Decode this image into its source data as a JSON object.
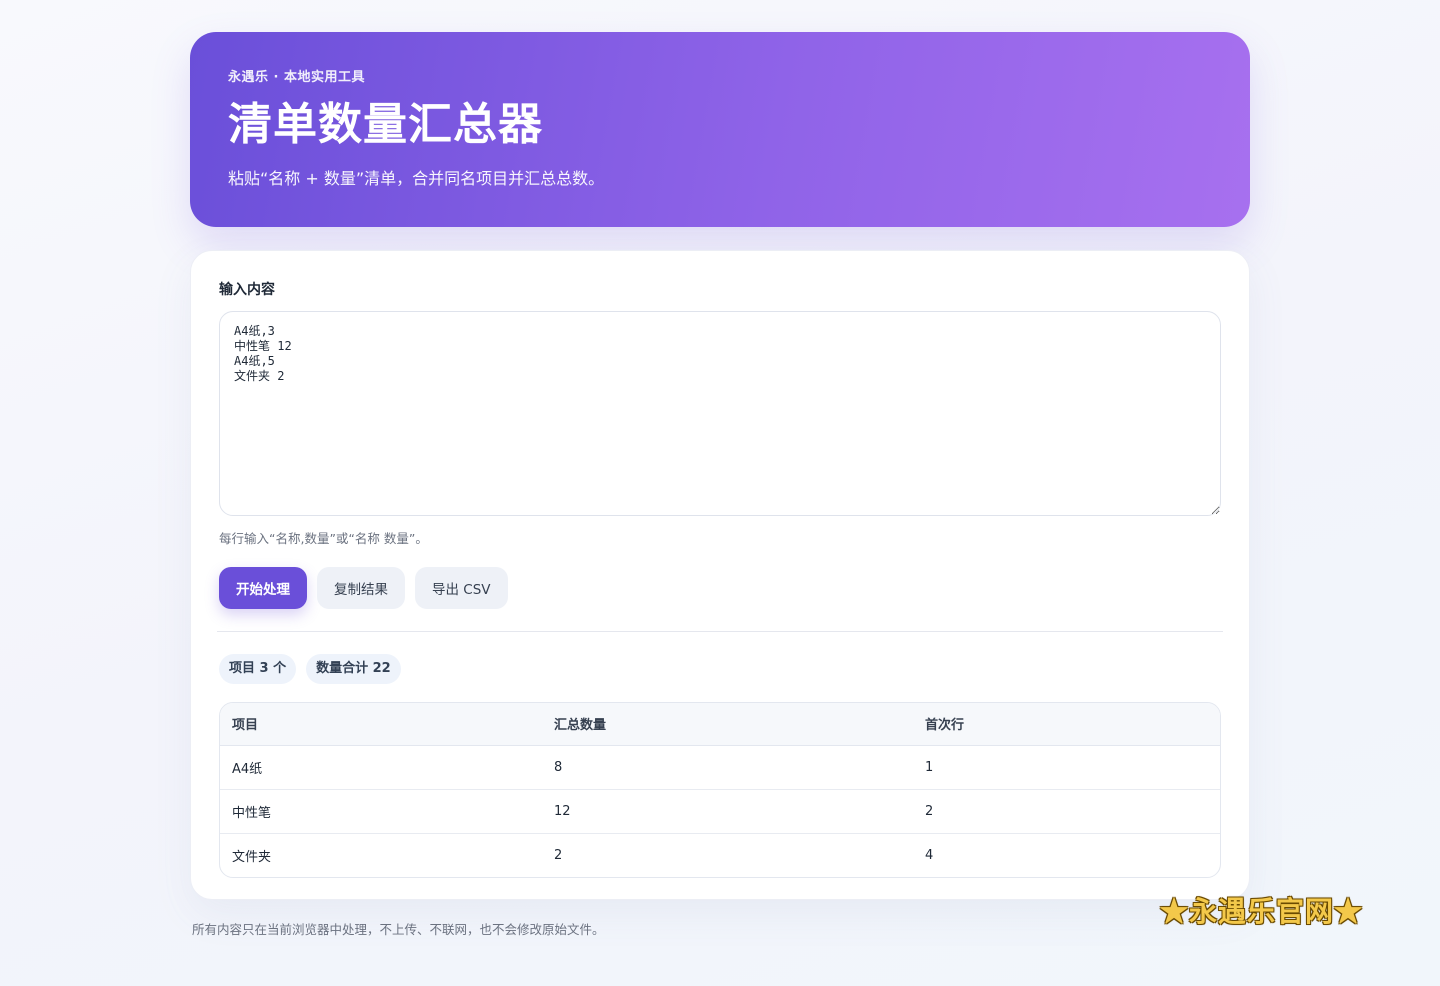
{
  "hero": {
    "kicker": "永遇乐 · 本地实用工具",
    "title": "清单数量汇总器",
    "subtitle": "粘贴“名称 + 数量”清单，合并同名项目并汇总总数。"
  },
  "input": {
    "label": "输入内容",
    "value": "A4纸,3\n中性笔 12\nA4纸,5\n文件夹 2",
    "hint": "每行输入“名称,数量”或“名称 数量”。"
  },
  "buttons": {
    "process": "开始处理",
    "copy": "复制结果",
    "export": "导出 CSV"
  },
  "summary": {
    "items": "项目 3 个",
    "total": "数量合计 22"
  },
  "table": {
    "headers": [
      "项目",
      "汇总数量",
      "首次行"
    ],
    "rows": [
      [
        "A4纸",
        "8",
        "1"
      ],
      [
        "中性笔",
        "12",
        "2"
      ],
      [
        "文件夹",
        "2",
        "4"
      ]
    ]
  },
  "footer": "所有内容只在当前浏览器中处理，不上传、不联网，也不会修改原始文件。",
  "watermark": "★永遇乐官网★",
  "colors": {
    "accent": "#6a4fd9",
    "hero_gradient_end": "#a770ef"
  }
}
